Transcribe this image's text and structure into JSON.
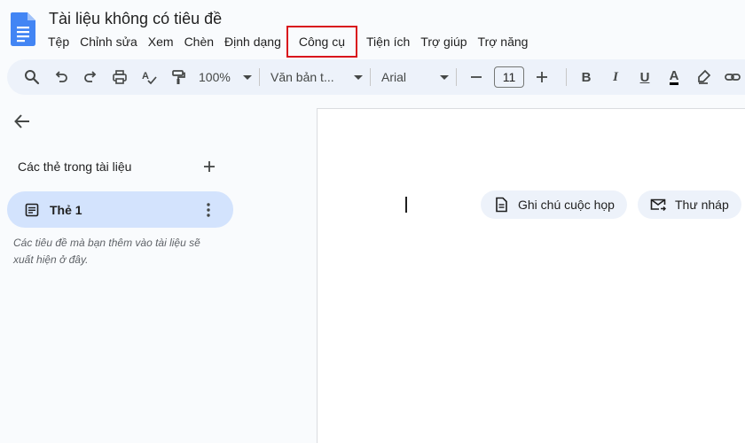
{
  "document": {
    "title": "Tài liệu không có tiêu đề",
    "icon": "google-docs-icon"
  },
  "menubar": {
    "items": [
      {
        "label": "Tệp"
      },
      {
        "label": "Chỉnh sửa"
      },
      {
        "label": "Xem"
      },
      {
        "label": "Chèn"
      },
      {
        "label": "Định dạng"
      },
      {
        "label": "Công cụ",
        "highlighted": true
      },
      {
        "label": "Tiện ích"
      },
      {
        "label": "Trợ giúp"
      },
      {
        "label": "Trợ năng"
      }
    ],
    "highlight_color": "#d9141c"
  },
  "toolbar": {
    "zoom": "100%",
    "style": "Văn bản t...",
    "font": "Arial",
    "font_size": "11",
    "bold": "B",
    "italic": "I",
    "underline": "U",
    "text_color": "A"
  },
  "sidebar": {
    "heading": "Các thẻ trong tài liệu",
    "tabs": [
      {
        "label": "Thẻ 1",
        "selected": true
      }
    ],
    "hint": "Các tiêu đề mà bạn thêm vào tài liệu sẽ xuất hiện ở đây."
  },
  "chips": {
    "meeting_notes": "Ghi chú cuộc họp",
    "email_draft": "Thư nháp"
  },
  "colors": {
    "toolbar_bg": "#edf2fa",
    "selected_tab_bg": "#d3e3fd",
    "docs_blue": "#4285f4",
    "page_bg": "#f9fbfd"
  }
}
